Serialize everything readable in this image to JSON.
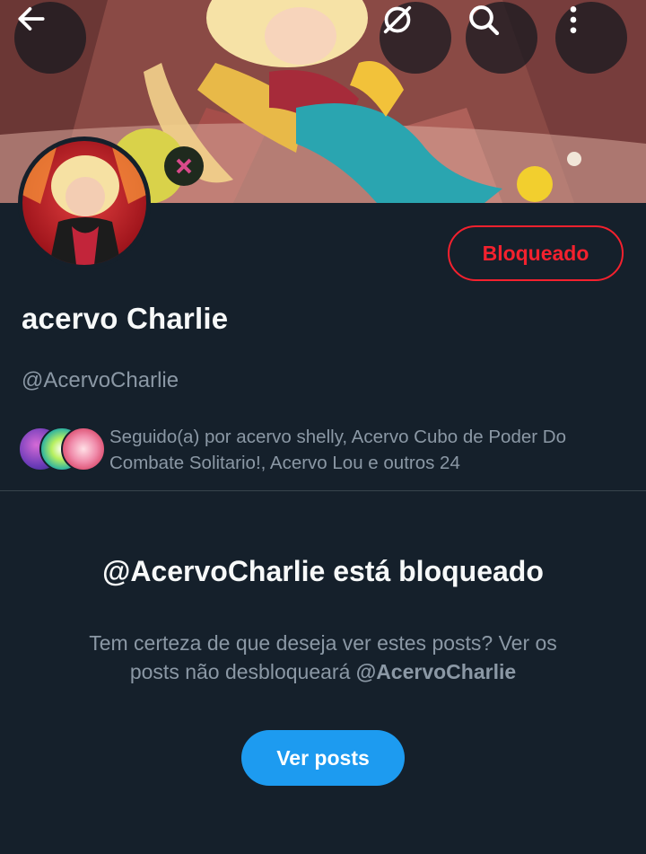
{
  "header": {
    "back_icon": "arrow-left-icon",
    "grok_icon": "grok-slash-circle-icon",
    "search_icon": "search-icon",
    "more_icon": "more-vertical-icon"
  },
  "profile": {
    "display_name": "acervo Charlie",
    "handle": "@AcervoCharlie",
    "block_status_label": "Bloqueado",
    "followed_by_text": "Seguido(a) por acervo shelly, Acervo Cubo de Poder Do Combate Solitario!, Acervo Lou e outros 24"
  },
  "blocked_notice": {
    "title": "@AcervoCharlie está bloqueado",
    "description": "Tem certeza de que deseja ver estes posts? Ver os posts não desbloqueará",
    "description_handle": "@AcervoCharlie",
    "view_posts_label": "Ver posts"
  },
  "colors": {
    "background": "#15202b",
    "danger": "#f4212e",
    "accent": "#1d9bf0",
    "secondary_text": "#8b98a5"
  }
}
